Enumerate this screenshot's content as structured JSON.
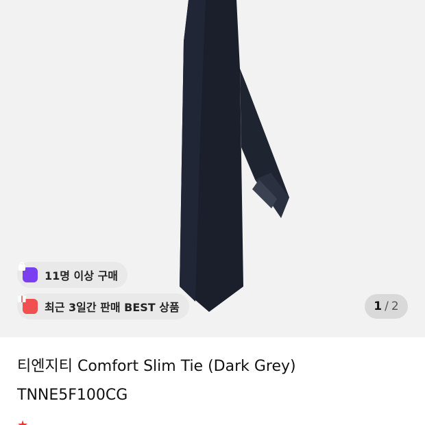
{
  "product": {
    "image_counter": {
      "current": "1",
      "separator": "/",
      "total": "2"
    },
    "badges": {
      "buyers": {
        "icon": "shopping-bag-icon",
        "label": "11명 이상 구매"
      },
      "best": {
        "icon": "gift-icon",
        "label": "최근 3일간 판매 BEST 상품"
      }
    },
    "title": "티엔지티 Comfort Slim Tie (Dark Grey)",
    "code": "TNNE5F100CG"
  },
  "colors": {
    "accent_purple": "#7b3ff2",
    "accent_red": "#f05050",
    "rating_star": "#e53935"
  }
}
